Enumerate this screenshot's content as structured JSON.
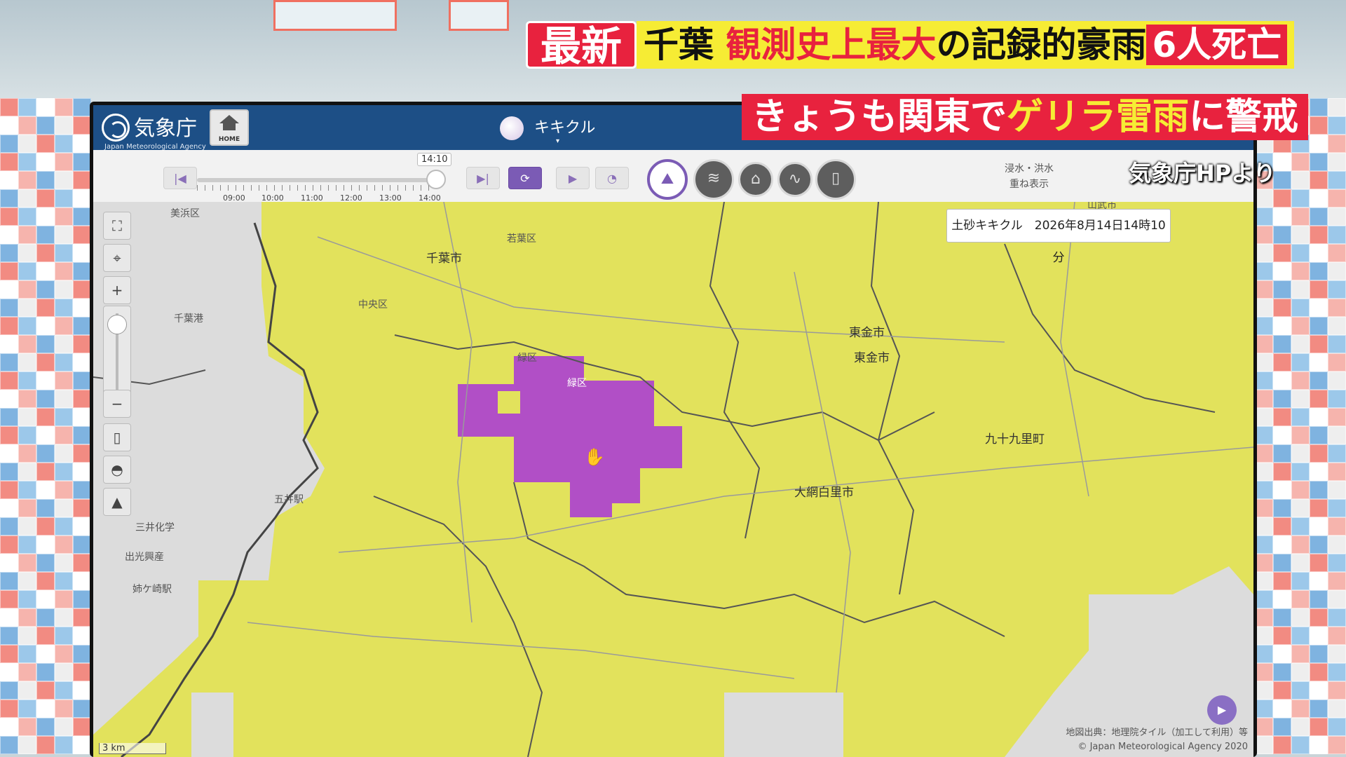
{
  "captions": {
    "badge": "最新",
    "headline_part1": "千葉",
    "headline_red": "観測史上最大",
    "headline_part2": "の記録的豪雨",
    "headline_box": "6人死亡",
    "sub_part1": "きょうも関東で",
    "sub_yellow": "ゲリラ雷雨",
    "sub_part2": "に警戒",
    "credit": "気象庁HPより"
  },
  "jma": {
    "name": "気象庁",
    "name_en": "Japan Meteorological Agency",
    "home_label": "HOME",
    "service_title": "キキクル",
    "caret": "▾"
  },
  "toolbar": {
    "current_time": "14:10",
    "time_ticks": [
      "09:00",
      "10:00",
      "11:00",
      "12:00",
      "13:00",
      "14:00"
    ],
    "overlay_label_line1": "浸水・洪水",
    "overlay_label_line2": "重ね表示",
    "icons": [
      "skip-start-icon",
      "skip-end-icon",
      "refresh-icon",
      "play-icon",
      "speed-icon"
    ],
    "layers": [
      "landslide-icon",
      "flood-icon",
      "inundation-icon",
      "river-icon",
      "map-icon"
    ]
  },
  "map": {
    "info": "土砂キキクル　2026年8月14日14時10分",
    "controls": [
      "fullscreen-icon",
      "location-pin-icon",
      "zoom-in-icon",
      "zoom-out-icon",
      "basemap-icon",
      "water-drop-icon",
      "terrain-icon"
    ],
    "zoom_in": "+",
    "zoom_out": "−",
    "scale": "3 km",
    "attribution_line1": "地図出典：地理院タイル（加工して利用）等",
    "attribution_line2": "© Japan Meteorological Agency 2020",
    "labels": {
      "chiba_city": "千葉市",
      "wakaba": "若葉区",
      "chuo": "中央区",
      "midori": "緑区",
      "midori2": "緑区",
      "mihama": "美浜区",
      "chiba_port": "千葉港",
      "togane": "東金市",
      "togane2": "東金市",
      "oamishirasato": "大網白里市",
      "kujukuri": "九十九里町",
      "goi": "五井駅",
      "mitsui": "三井化学",
      "idemitsu": "出光興産",
      "anegasaki": "姉ケ崎駅",
      "sammu": "山武市"
    },
    "warning_colors": {
      "caution": "#e2e25c",
      "danger": "#b14fc6",
      "none": "#dcdcdc"
    }
  }
}
